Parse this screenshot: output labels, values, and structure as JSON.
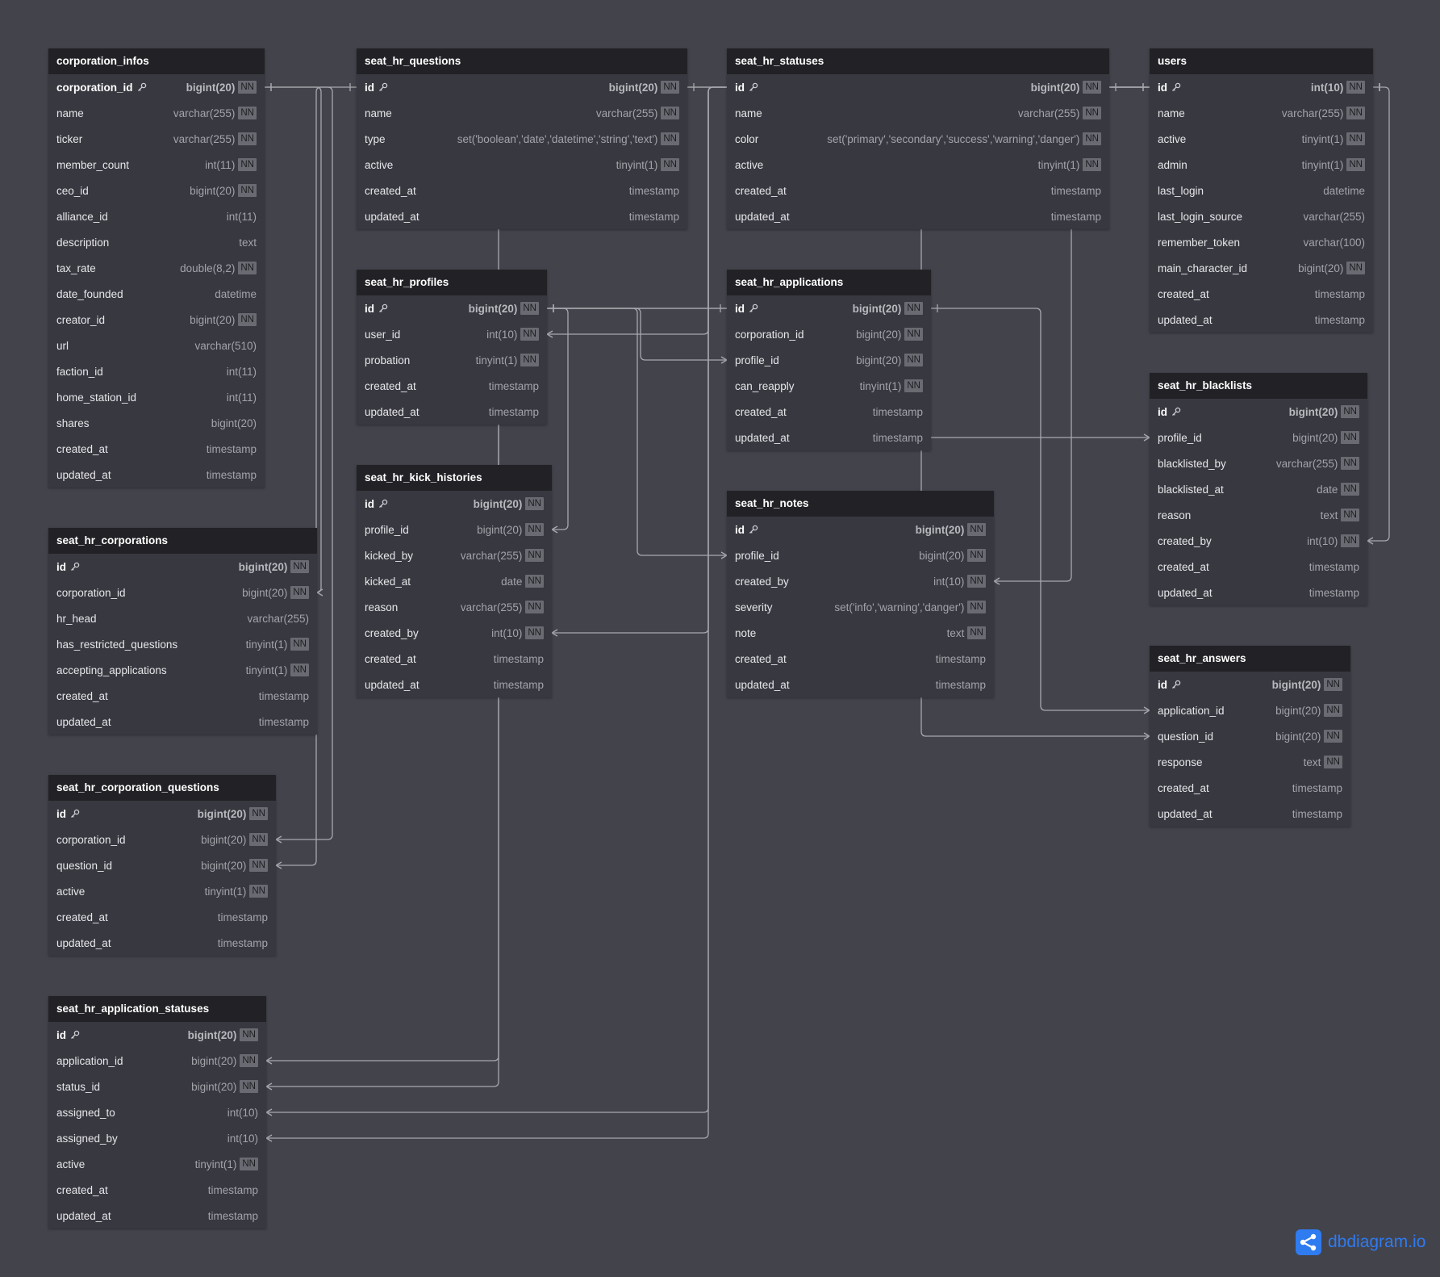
{
  "tables": [
    {
      "name": "corporation_infos",
      "fields": [
        {
          "name": "corporation_id",
          "type": "bigint(20)",
          "nn": true,
          "pk": true
        },
        {
          "name": "name",
          "type": "varchar(255)",
          "nn": true
        },
        {
          "name": "ticker",
          "type": "varchar(255)",
          "nn": true
        },
        {
          "name": "member_count",
          "type": "int(11)",
          "nn": true
        },
        {
          "name": "ceo_id",
          "type": "bigint(20)",
          "nn": true
        },
        {
          "name": "alliance_id",
          "type": "int(11)",
          "nn": false
        },
        {
          "name": "description",
          "type": "text",
          "nn": false
        },
        {
          "name": "tax_rate",
          "type": "double(8,2)",
          "nn": true
        },
        {
          "name": "date_founded",
          "type": "datetime",
          "nn": false
        },
        {
          "name": "creator_id",
          "type": "bigint(20)",
          "nn": true
        },
        {
          "name": "url",
          "type": "varchar(510)",
          "nn": false
        },
        {
          "name": "faction_id",
          "type": "int(11)",
          "nn": false
        },
        {
          "name": "home_station_id",
          "type": "int(11)",
          "nn": false
        },
        {
          "name": "shares",
          "type": "bigint(20)",
          "nn": false
        },
        {
          "name": "created_at",
          "type": "timestamp",
          "nn": false
        },
        {
          "name": "updated_at",
          "type": "timestamp",
          "nn": false
        }
      ]
    },
    {
      "name": "seat_hr_questions",
      "fields": [
        {
          "name": "id",
          "type": "bigint(20)",
          "nn": true,
          "pk": true
        },
        {
          "name": "name",
          "type": "varchar(255)",
          "nn": true
        },
        {
          "name": "type",
          "type": "set('boolean','date','datetime','string','text')",
          "nn": true
        },
        {
          "name": "active",
          "type": "tinyint(1)",
          "nn": true
        },
        {
          "name": "created_at",
          "type": "timestamp",
          "nn": false
        },
        {
          "name": "updated_at",
          "type": "timestamp",
          "nn": false
        }
      ]
    },
    {
      "name": "seat_hr_statuses",
      "fields": [
        {
          "name": "id",
          "type": "bigint(20)",
          "nn": true,
          "pk": true
        },
        {
          "name": "name",
          "type": "varchar(255)",
          "nn": true
        },
        {
          "name": "color",
          "type": "set('primary','secondary','success','warning','danger')",
          "nn": true
        },
        {
          "name": "active",
          "type": "tinyint(1)",
          "nn": true
        },
        {
          "name": "created_at",
          "type": "timestamp",
          "nn": false
        },
        {
          "name": "updated_at",
          "type": "timestamp",
          "nn": false
        }
      ]
    },
    {
      "name": "users",
      "fields": [
        {
          "name": "id",
          "type": "int(10)",
          "nn": true,
          "pk": true
        },
        {
          "name": "name",
          "type": "varchar(255)",
          "nn": true
        },
        {
          "name": "active",
          "type": "tinyint(1)",
          "nn": true
        },
        {
          "name": "admin",
          "type": "tinyint(1)",
          "nn": true
        },
        {
          "name": "last_login",
          "type": "datetime",
          "nn": false
        },
        {
          "name": "last_login_source",
          "type": "varchar(255)",
          "nn": false
        },
        {
          "name": "remember_token",
          "type": "varchar(100)",
          "nn": false
        },
        {
          "name": "main_character_id",
          "type": "bigint(20)",
          "nn": true
        },
        {
          "name": "created_at",
          "type": "timestamp",
          "nn": false
        },
        {
          "name": "updated_at",
          "type": "timestamp",
          "nn": false
        }
      ]
    },
    {
      "name": "seat_hr_profiles",
      "fields": [
        {
          "name": "id",
          "type": "bigint(20)",
          "nn": true,
          "pk": true
        },
        {
          "name": "user_id",
          "type": "int(10)",
          "nn": true
        },
        {
          "name": "probation",
          "type": "tinyint(1)",
          "nn": true
        },
        {
          "name": "created_at",
          "type": "timestamp",
          "nn": false
        },
        {
          "name": "updated_at",
          "type": "timestamp",
          "nn": false
        }
      ]
    },
    {
      "name": "seat_hr_applications",
      "fields": [
        {
          "name": "id",
          "type": "bigint(20)",
          "nn": true,
          "pk": true
        },
        {
          "name": "corporation_id",
          "type": "bigint(20)",
          "nn": true
        },
        {
          "name": "profile_id",
          "type": "bigint(20)",
          "nn": true
        },
        {
          "name": "can_reapply",
          "type": "tinyint(1)",
          "nn": true
        },
        {
          "name": "created_at",
          "type": "timestamp",
          "nn": false
        },
        {
          "name": "updated_at",
          "type": "timestamp",
          "nn": false
        }
      ]
    },
    {
      "name": "seat_hr_blacklists",
      "fields": [
        {
          "name": "id",
          "type": "bigint(20)",
          "nn": true,
          "pk": true
        },
        {
          "name": "profile_id",
          "type": "bigint(20)",
          "nn": true
        },
        {
          "name": "blacklisted_by",
          "type": "varchar(255)",
          "nn": true
        },
        {
          "name": "blacklisted_at",
          "type": "date",
          "nn": true
        },
        {
          "name": "reason",
          "type": "text",
          "nn": true
        },
        {
          "name": "created_by",
          "type": "int(10)",
          "nn": true
        },
        {
          "name": "created_at",
          "type": "timestamp",
          "nn": false
        },
        {
          "name": "updated_at",
          "type": "timestamp",
          "nn": false
        }
      ]
    },
    {
      "name": "seat_hr_kick_histories",
      "fields": [
        {
          "name": "id",
          "type": "bigint(20)",
          "nn": true,
          "pk": true
        },
        {
          "name": "profile_id",
          "type": "bigint(20)",
          "nn": true
        },
        {
          "name": "kicked_by",
          "type": "varchar(255)",
          "nn": true
        },
        {
          "name": "kicked_at",
          "type": "date",
          "nn": true
        },
        {
          "name": "reason",
          "type": "varchar(255)",
          "nn": true
        },
        {
          "name": "created_by",
          "type": "int(10)",
          "nn": true
        },
        {
          "name": "created_at",
          "type": "timestamp",
          "nn": false
        },
        {
          "name": "updated_at",
          "type": "timestamp",
          "nn": false
        }
      ]
    },
    {
      "name": "seat_hr_notes",
      "fields": [
        {
          "name": "id",
          "type": "bigint(20)",
          "nn": true,
          "pk": true
        },
        {
          "name": "profile_id",
          "type": "bigint(20)",
          "nn": true
        },
        {
          "name": "created_by",
          "type": "int(10)",
          "nn": true
        },
        {
          "name": "severity",
          "type": "set('info','warning','danger')",
          "nn": true
        },
        {
          "name": "note",
          "type": "text",
          "nn": true
        },
        {
          "name": "created_at",
          "type": "timestamp",
          "nn": false
        },
        {
          "name": "updated_at",
          "type": "timestamp",
          "nn": false
        }
      ]
    },
    {
      "name": "seat_hr_corporations",
      "fields": [
        {
          "name": "id",
          "type": "bigint(20)",
          "nn": true,
          "pk": true
        },
        {
          "name": "corporation_id",
          "type": "bigint(20)",
          "nn": true
        },
        {
          "name": "hr_head",
          "type": "varchar(255)",
          "nn": false
        },
        {
          "name": "has_restricted_questions",
          "type": "tinyint(1)",
          "nn": true
        },
        {
          "name": "accepting_applications",
          "type": "tinyint(1)",
          "nn": true
        },
        {
          "name": "created_at",
          "type": "timestamp",
          "nn": false
        },
        {
          "name": "updated_at",
          "type": "timestamp",
          "nn": false
        }
      ]
    },
    {
      "name": "seat_hr_answers",
      "fields": [
        {
          "name": "id",
          "type": "bigint(20)",
          "nn": true,
          "pk": true
        },
        {
          "name": "application_id",
          "type": "bigint(20)",
          "nn": true
        },
        {
          "name": "question_id",
          "type": "bigint(20)",
          "nn": true
        },
        {
          "name": "response",
          "type": "text",
          "nn": true
        },
        {
          "name": "created_at",
          "type": "timestamp",
          "nn": false
        },
        {
          "name": "updated_at",
          "type": "timestamp",
          "nn": false
        }
      ]
    },
    {
      "name": "seat_hr_corporation_questions",
      "fields": [
        {
          "name": "id",
          "type": "bigint(20)",
          "nn": true,
          "pk": true
        },
        {
          "name": "corporation_id",
          "type": "bigint(20)",
          "nn": true
        },
        {
          "name": "question_id",
          "type": "bigint(20)",
          "nn": true
        },
        {
          "name": "active",
          "type": "tinyint(1)",
          "nn": true
        },
        {
          "name": "created_at",
          "type": "timestamp",
          "nn": false
        },
        {
          "name": "updated_at",
          "type": "timestamp",
          "nn": false
        }
      ]
    },
    {
      "name": "seat_hr_application_statuses",
      "fields": [
        {
          "name": "id",
          "type": "bigint(20)",
          "nn": true,
          "pk": true
        },
        {
          "name": "application_id",
          "type": "bigint(20)",
          "nn": true
        },
        {
          "name": "status_id",
          "type": "bigint(20)",
          "nn": true
        },
        {
          "name": "assigned_to",
          "type": "int(10)",
          "nn": false
        },
        {
          "name": "assigned_by",
          "type": "int(10)",
          "nn": false
        },
        {
          "name": "active",
          "type": "tinyint(1)",
          "nn": true
        },
        {
          "name": "created_at",
          "type": "timestamp",
          "nn": false
        },
        {
          "name": "updated_at",
          "type": "timestamp",
          "nn": false
        }
      ]
    }
  ],
  "nn_label": "NN",
  "brand": {
    "text": "dbdiagram.io",
    "color": "#2f7bf0"
  },
  "colors": {
    "background": "#43434c",
    "header": "#222226",
    "body": "#383840",
    "line": "#a8a8ae"
  },
  "relations": [
    {
      "from": "seat_hr_corporations.corporation_id",
      "to": "corporation_infos.corporation_id"
    },
    {
      "from": "seat_hr_corporation_questions.corporation_id",
      "to": "corporation_infos.corporation_id"
    },
    {
      "from": "seat_hr_corporation_questions.question_id",
      "to": "seat_hr_questions.id"
    },
    {
      "from": "seat_hr_answers.question_id",
      "to": "seat_hr_questions.id"
    },
    {
      "from": "seat_hr_application_statuses.status_id",
      "to": "seat_hr_statuses.id"
    },
    {
      "from": "seat_hr_application_statuses.application_id",
      "to": "seat_hr_applications.id"
    },
    {
      "from": "seat_hr_application_statuses.assigned_to",
      "to": "users.id"
    },
    {
      "from": "seat_hr_application_statuses.assigned_by",
      "to": "users.id"
    },
    {
      "from": "seat_hr_profiles.user_id",
      "to": "users.id"
    },
    {
      "from": "seat_hr_applications.profile_id",
      "to": "seat_hr_profiles.id"
    },
    {
      "from": "seat_hr_kick_histories.profile_id",
      "to": "seat_hr_profiles.id"
    },
    {
      "from": "seat_hr_notes.profile_id",
      "to": "seat_hr_profiles.id"
    },
    {
      "from": "seat_hr_blacklists.profile_id",
      "to": "seat_hr_profiles.id"
    },
    {
      "from": "seat_hr_blacklists.created_by",
      "to": "users.id"
    },
    {
      "from": "seat_hr_notes.created_by",
      "to": "users.id"
    },
    {
      "from": "seat_hr_kick_histories.created_by",
      "to": "users.id"
    },
    {
      "from": "seat_hr_answers.application_id",
      "to": "seat_hr_applications.id"
    }
  ]
}
